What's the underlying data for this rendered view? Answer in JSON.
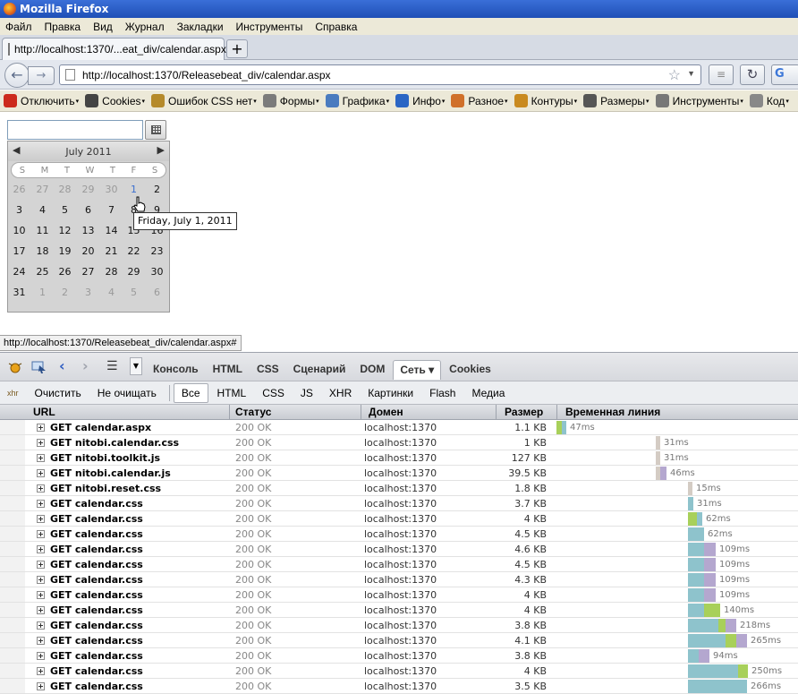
{
  "window": {
    "title": "Mozilla Firefox"
  },
  "menu": [
    "Файл",
    "Правка",
    "Вид",
    "Журнал",
    "Закладки",
    "Инструменты",
    "Справка"
  ],
  "tab": {
    "title": "http://localhost:1370/...eat_div/calendar.aspx",
    "new_tab": "+"
  },
  "nav": {
    "url": "http://localhost:1370/Releasebeat_div/calendar.aspx",
    "g_label": "G"
  },
  "devtoolbar": [
    {
      "label": "Отключить",
      "icon": "disable-icon",
      "color": "#cc2a1c"
    },
    {
      "label": "Cookies",
      "icon": "user-icon",
      "color": "#444444"
    },
    {
      "label": "Ошибок CSS нет",
      "icon": "wand-icon",
      "color": "#b58a2a"
    },
    {
      "label": "Формы",
      "icon": "form-icon",
      "color": "#7b7b7b"
    },
    {
      "label": "Графика",
      "icon": "image-icon",
      "color": "#4a7bbf"
    },
    {
      "label": "Инфо",
      "icon": "info-icon",
      "color": "#2b66c4"
    },
    {
      "label": "Разное",
      "icon": "misc-icon",
      "color": "#d0702a"
    },
    {
      "label": "Контуры",
      "icon": "pencil-icon",
      "color": "#c98a1f"
    },
    {
      "label": "Размеры",
      "icon": "resize-icon",
      "color": "#555555"
    },
    {
      "label": "Инструменты",
      "icon": "tools-icon",
      "color": "#777777"
    },
    {
      "label": "Код",
      "icon": "code-icon",
      "color": "#888888"
    }
  ],
  "calendar": {
    "title": "July 2011",
    "prev": "◀",
    "next": "▶",
    "weekdays": [
      "S",
      "M",
      "T",
      "W",
      "T",
      "F",
      "S"
    ],
    "weeks": [
      [
        {
          "d": "26",
          "o": true
        },
        {
          "d": "27",
          "o": true
        },
        {
          "d": "28",
          "o": true
        },
        {
          "d": "29",
          "o": true
        },
        {
          "d": "30",
          "o": true
        },
        {
          "d": "1",
          "t": true
        },
        {
          "d": "2"
        }
      ],
      [
        {
          "d": "3"
        },
        {
          "d": "4"
        },
        {
          "d": "5"
        },
        {
          "d": "6"
        },
        {
          "d": "7"
        },
        {
          "d": "8"
        },
        {
          "d": "9"
        }
      ],
      [
        {
          "d": "10"
        },
        {
          "d": "11"
        },
        {
          "d": "12"
        },
        {
          "d": "13"
        },
        {
          "d": "14"
        },
        {
          "d": "15"
        },
        {
          "d": "16"
        }
      ],
      [
        {
          "d": "17"
        },
        {
          "d": "18"
        },
        {
          "d": "19"
        },
        {
          "d": "20"
        },
        {
          "d": "21"
        },
        {
          "d": "22"
        },
        {
          "d": "23"
        }
      ],
      [
        {
          "d": "24"
        },
        {
          "d": "25"
        },
        {
          "d": "26"
        },
        {
          "d": "27"
        },
        {
          "d": "28"
        },
        {
          "d": "29"
        },
        {
          "d": "30"
        }
      ],
      [
        {
          "d": "31"
        },
        {
          "d": "1",
          "o": true
        },
        {
          "d": "2",
          "o": true
        },
        {
          "d": "3",
          "o": true
        },
        {
          "d": "4",
          "o": true
        },
        {
          "d": "5",
          "o": true
        },
        {
          "d": "6",
          "o": true
        }
      ]
    ],
    "tooltip": "Friday, July 1, 2011"
  },
  "statusbar": "http://localhost:1370/Releasebeat_div/calendar.aspx#",
  "firebug": {
    "tabs": [
      "Консоль",
      "HTML",
      "CSS",
      "Сценарий",
      "DOM",
      "Сеть ▾",
      "Cookies"
    ],
    "active_tab": 5,
    "subbar": [
      "Очистить",
      "Не очищать",
      "Все",
      "HTML",
      "CSS",
      "JS",
      "XHR",
      "Картинки",
      "Flash",
      "Медиа"
    ],
    "active_filter": 2,
    "columns": {
      "url": "URL",
      "status": "Статус",
      "domain": "Домен",
      "size": "Размер",
      "timeline": "Временная линия"
    },
    "colors": {
      "teal": "#8ec3cc",
      "green": "#a8d05a",
      "purple": "#b4a7cf",
      "gray": "#d4ccc4"
    },
    "rows": [
      {
        "url": "GET calendar.aspx",
        "status": "200 OK",
        "domain": "localhost:1370",
        "size": "1.1 KB",
        "time": "47ms",
        "start": 0,
        "segs": [
          [
            "green",
            6
          ],
          [
            "teal",
            5
          ]
        ]
      },
      {
        "url": "GET nitobi.calendar.css",
        "status": "200 OK",
        "domain": "localhost:1370",
        "size": "1 KB",
        "time": "31ms",
        "start": 111,
        "segs": [
          [
            "gray",
            5
          ]
        ]
      },
      {
        "url": "GET nitobi.toolkit.js",
        "status": "200 OK",
        "domain": "localhost:1370",
        "size": "127 KB",
        "time": "31ms",
        "start": 111,
        "segs": [
          [
            "gray",
            5
          ]
        ]
      },
      {
        "url": "GET nitobi.calendar.js",
        "status": "200 OK",
        "domain": "localhost:1370",
        "size": "39.5 KB",
        "time": "46ms",
        "start": 111,
        "segs": [
          [
            "gray",
            5
          ],
          [
            "purple",
            7
          ]
        ]
      },
      {
        "url": "GET nitobi.reset.css",
        "status": "200 OK",
        "domain": "localhost:1370",
        "size": "1.8 KB",
        "time": "15ms",
        "start": 147,
        "segs": [
          [
            "gray",
            5
          ]
        ]
      },
      {
        "url": "GET calendar.css",
        "status": "200 OK",
        "domain": "localhost:1370",
        "size": "3.7 KB",
        "time": "31ms",
        "start": 147,
        "segs": [
          [
            "teal",
            6
          ]
        ]
      },
      {
        "url": "GET calendar.css",
        "status": "200 OK",
        "domain": "localhost:1370",
        "size": "4 KB",
        "time": "62ms",
        "start": 147,
        "segs": [
          [
            "green",
            10
          ],
          [
            "teal",
            6
          ]
        ]
      },
      {
        "url": "GET calendar.css",
        "status": "200 OK",
        "domain": "localhost:1370",
        "size": "4.5 KB",
        "time": "62ms",
        "start": 147,
        "segs": [
          [
            "teal",
            18
          ]
        ]
      },
      {
        "url": "GET calendar.css",
        "status": "200 OK",
        "domain": "localhost:1370",
        "size": "4.6 KB",
        "time": "109ms",
        "start": 147,
        "segs": [
          [
            "teal",
            18
          ],
          [
            "purple",
            13
          ]
        ]
      },
      {
        "url": "GET calendar.css",
        "status": "200 OK",
        "domain": "localhost:1370",
        "size": "4.5 KB",
        "time": "109ms",
        "start": 147,
        "segs": [
          [
            "teal",
            18
          ],
          [
            "purple",
            13
          ]
        ]
      },
      {
        "url": "GET calendar.css",
        "status": "200 OK",
        "domain": "localhost:1370",
        "size": "4.3 KB",
        "time": "109ms",
        "start": 147,
        "segs": [
          [
            "teal",
            18
          ],
          [
            "purple",
            13
          ]
        ]
      },
      {
        "url": "GET calendar.css",
        "status": "200 OK",
        "domain": "localhost:1370",
        "size": "4 KB",
        "time": "109ms",
        "start": 147,
        "segs": [
          [
            "teal",
            18
          ],
          [
            "purple",
            13
          ]
        ]
      },
      {
        "url": "GET calendar.css",
        "status": "200 OK",
        "domain": "localhost:1370",
        "size": "4 KB",
        "time": "140ms",
        "start": 147,
        "segs": [
          [
            "teal",
            18
          ],
          [
            "green",
            18
          ]
        ]
      },
      {
        "url": "GET calendar.css",
        "status": "200 OK",
        "domain": "localhost:1370",
        "size": "3.8 KB",
        "time": "218ms",
        "start": 147,
        "segs": [
          [
            "teal",
            34
          ],
          [
            "green",
            8
          ],
          [
            "purple",
            12
          ]
        ]
      },
      {
        "url": "GET calendar.css",
        "status": "200 OK",
        "domain": "localhost:1370",
        "size": "4.1 KB",
        "time": "265ms",
        "start": 147,
        "segs": [
          [
            "teal",
            42
          ],
          [
            "green",
            12
          ],
          [
            "purple",
            12
          ]
        ]
      },
      {
        "url": "GET calendar.css",
        "status": "200 OK",
        "domain": "localhost:1370",
        "size": "3.8 KB",
        "time": "94ms",
        "start": 147,
        "segs": [
          [
            "teal",
            12
          ],
          [
            "purple",
            12
          ]
        ]
      },
      {
        "url": "GET calendar.css",
        "status": "200 OK",
        "domain": "localhost:1370",
        "size": "4 KB",
        "time": "250ms",
        "start": 147,
        "segs": [
          [
            "teal",
            56
          ],
          [
            "green",
            11
          ]
        ]
      },
      {
        "url": "GET calendar.css",
        "status": "200 OK",
        "domain": "localhost:1370",
        "size": "3.5 KB",
        "time": "266ms",
        "start": 147,
        "segs": [
          [
            "teal",
            66
          ]
        ]
      }
    ]
  }
}
